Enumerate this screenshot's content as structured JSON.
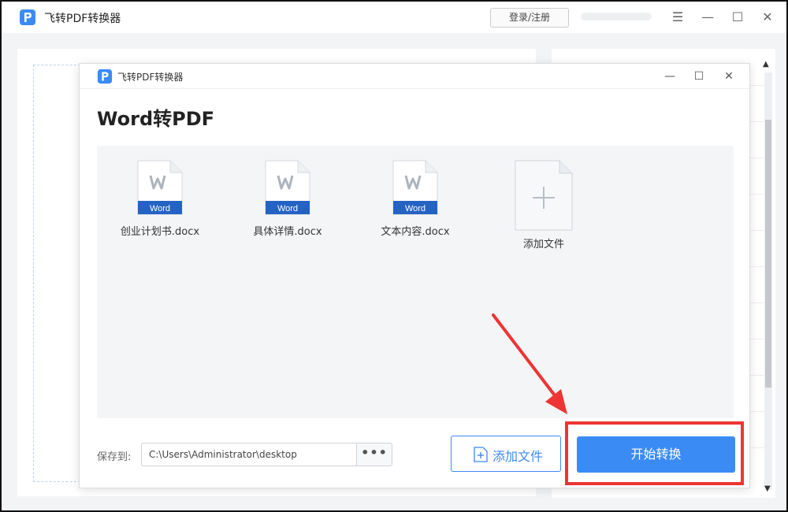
{
  "app": {
    "title": "飞转PDF转换器",
    "login_label": "登录/注册",
    "brand_color": "#3b8bf5",
    "logo_icon": "pdf-p-logo-icon"
  },
  "window_controls": {
    "menu_icon": "menu-icon",
    "minimize_icon": "minimize-icon",
    "maximize_icon": "maximize-icon",
    "close_icon": "close-icon"
  },
  "dialog": {
    "title": "飞转PDF转换器",
    "heading": "Word转PDF",
    "files": [
      {
        "name": "创业计划书.docx",
        "badge": "Word",
        "icon": "word-file-icon"
      },
      {
        "name": "具体详情.docx",
        "badge": "Word",
        "icon": "word-file-icon"
      },
      {
        "name": "文本内容.docx",
        "badge": "Word",
        "icon": "word-file-icon"
      }
    ],
    "add_tile_label": "添加文件",
    "save_to_label": "保存到:",
    "save_path": "C:\\Users\\Administrator\\desktop",
    "browse_label": "•••",
    "add_file_button": "添加文件",
    "start_button": "开始转换"
  },
  "annotation": {
    "highlight_color": "#ee3434"
  }
}
